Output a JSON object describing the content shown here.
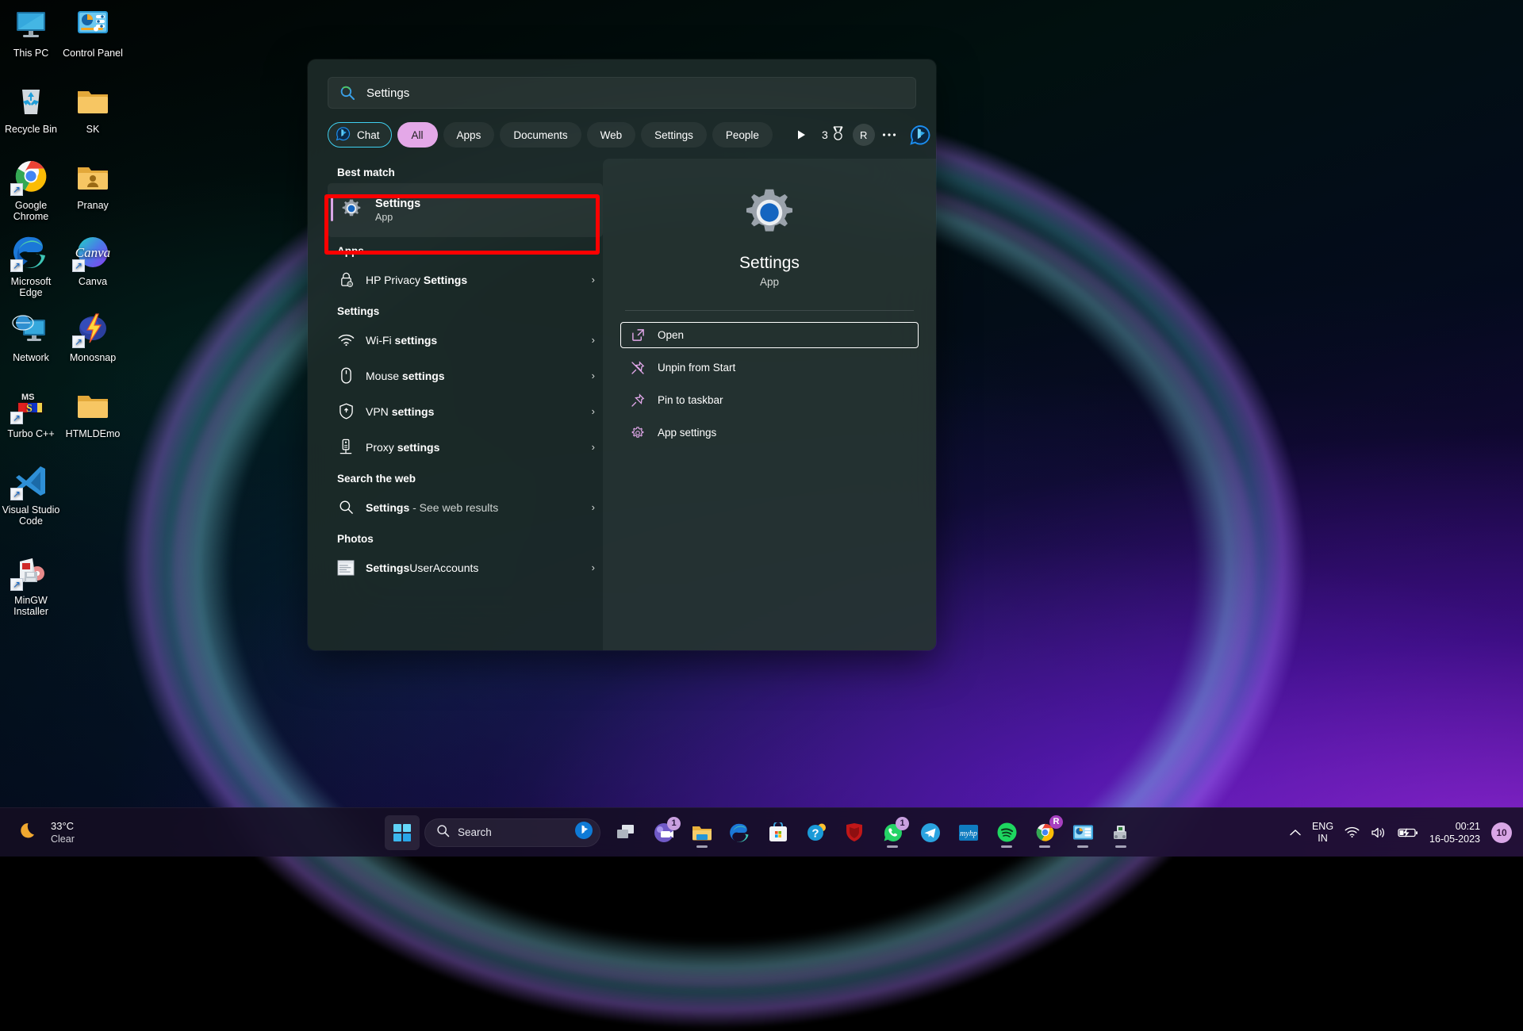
{
  "desktop": {
    "icons": [
      {
        "label": "This PC",
        "icon": "monitor-icon",
        "col": 0,
        "row": 0,
        "shortcut": false
      },
      {
        "label": "Control Panel",
        "icon": "control-panel-icon",
        "col": 1,
        "row": 0,
        "shortcut": false
      },
      {
        "label": "Recycle Bin",
        "icon": "recycle-bin-icon",
        "col": 0,
        "row": 1,
        "shortcut": false
      },
      {
        "label": "SK",
        "icon": "folder-icon",
        "col": 1,
        "row": 1,
        "shortcut": false
      },
      {
        "label": "Google Chrome",
        "icon": "chrome-icon",
        "col": 0,
        "row": 2,
        "shortcut": true
      },
      {
        "label": "Pranay",
        "icon": "user-folder-icon",
        "col": 1,
        "row": 2,
        "shortcut": false
      },
      {
        "label": "Microsoft Edge",
        "icon": "edge-icon",
        "col": 0,
        "row": 3,
        "shortcut": true
      },
      {
        "label": "Canva",
        "icon": "canva-icon",
        "col": 1,
        "row": 3,
        "shortcut": true
      },
      {
        "label": "Network",
        "icon": "network-icon",
        "col": 0,
        "row": 4,
        "shortcut": false
      },
      {
        "label": "Monosnap",
        "icon": "monosnap-icon",
        "col": 1,
        "row": 4,
        "shortcut": true
      },
      {
        "label": "Turbo C++",
        "icon": "turbo-cpp-icon",
        "col": 0,
        "row": 5,
        "shortcut": true
      },
      {
        "label": "HTMLDEmo",
        "icon": "folder-icon",
        "col": 1,
        "row": 5,
        "shortcut": false
      },
      {
        "label": "Visual Studio Code",
        "icon": "vscode-icon",
        "col": 0,
        "row": 6,
        "shortcut": true
      },
      {
        "label": "MinGW Installer",
        "icon": "mingw-installer-icon",
        "col": 0,
        "row": 7,
        "shortcut": true
      }
    ]
  },
  "search": {
    "query": "Settings",
    "placeholder": "Search",
    "search_icon": "bing-search-icon",
    "pills": [
      {
        "label": "Chat",
        "state": "outlined",
        "icon": "bing-chat-icon"
      },
      {
        "label": "All",
        "state": "selected"
      },
      {
        "label": "Apps",
        "state": "normal"
      },
      {
        "label": "Documents",
        "state": "normal"
      },
      {
        "label": "Web",
        "state": "normal"
      },
      {
        "label": "Settings",
        "state": "normal"
      },
      {
        "label": "People",
        "state": "normal"
      }
    ],
    "actions": {
      "scroll_right_icon": "play-right-icon",
      "rewards_count": "3",
      "rewards_icon": "medal-icon",
      "avatar_letter": "R",
      "more_icon": "ellipsis-icon",
      "bing_icon": "bing-chat-icon"
    },
    "best_match": {
      "heading": "Best match",
      "title": "Settings",
      "subtitle": "App",
      "icon": "settings-gear-icon"
    },
    "groups": [
      {
        "heading": "Apps",
        "items": [
          {
            "prefix": "HP Privacy ",
            "bold": "Settings",
            "suffix": "",
            "icon": "hp-privacy-lock-icon",
            "chevron": "›"
          }
        ]
      },
      {
        "heading": "Settings",
        "items": [
          {
            "prefix": "Wi-Fi ",
            "bold": "settings",
            "suffix": "",
            "icon": "wifi-icon",
            "chevron": "›"
          },
          {
            "prefix": "Mouse ",
            "bold": "settings",
            "suffix": "",
            "icon": "mouse-icon",
            "chevron": "›"
          },
          {
            "prefix": "VPN ",
            "bold": "settings",
            "suffix": "",
            "icon": "vpn-shield-icon",
            "chevron": "›"
          },
          {
            "prefix": "Proxy ",
            "bold": "settings",
            "suffix": "",
            "icon": "proxy-server-icon",
            "chevron": "›"
          }
        ]
      },
      {
        "heading": "Search the web",
        "items": [
          {
            "prefix": "",
            "bold": "Settings",
            "suffix": " - See web results",
            "icon": "magnifier-icon",
            "chevron": "›"
          }
        ]
      },
      {
        "heading": "Photos",
        "items": [
          {
            "prefix": "",
            "bold": "Settings",
            "suffix": "UserAccounts",
            "icon": "photo-thumbnail-icon",
            "chevron": "›"
          }
        ]
      }
    ],
    "preview": {
      "icon": "settings-gear-icon",
      "title": "Settings",
      "subtitle": "App",
      "actions": [
        {
          "label": "Open",
          "icon": "open-external-icon",
          "focused": true
        },
        {
          "label": "Unpin from Start",
          "icon": "unpin-icon",
          "focused": false
        },
        {
          "label": "Pin to taskbar",
          "icon": "pin-icon",
          "focused": false
        },
        {
          "label": "App settings",
          "icon": "gear-icon",
          "focused": false
        }
      ]
    }
  },
  "annotation": {
    "color": "#ff0000",
    "target": "best-match-settings-row"
  },
  "taskbar": {
    "weather": {
      "temperature": "33°C",
      "condition": "Clear",
      "icon": "moon-icon"
    },
    "start": {
      "icon": "windows-start-icon",
      "active": true
    },
    "search_box": {
      "placeholder": "Search",
      "icon": "magnifier-icon",
      "bing_icon": "bing-chat-icon"
    },
    "items": [
      {
        "name": "task-view",
        "icon": "task-view-icon",
        "badge": "",
        "running": false
      },
      {
        "name": "teams",
        "icon": "teams-icon",
        "badge": "1",
        "running": false
      },
      {
        "name": "file-explorer",
        "icon": "file-explorer-icon",
        "badge": "",
        "running": true
      },
      {
        "name": "microsoft-edge",
        "icon": "edge-icon",
        "badge": "",
        "running": false
      },
      {
        "name": "microsoft-store",
        "icon": "store-icon",
        "badge": "",
        "running": false
      },
      {
        "name": "get-help",
        "icon": "get-help-icon",
        "badge": "",
        "running": false
      },
      {
        "name": "mcafee",
        "icon": "mcafee-icon",
        "badge": "",
        "running": false
      },
      {
        "name": "whatsapp",
        "icon": "whatsapp-icon",
        "badge": "1",
        "running": true
      },
      {
        "name": "telegram",
        "icon": "telegram-icon",
        "badge": "",
        "running": false
      },
      {
        "name": "myhp",
        "icon": "myhp-icon",
        "badge": "",
        "running": false
      },
      {
        "name": "spotify",
        "icon": "spotify-icon",
        "badge": "",
        "running": true
      },
      {
        "name": "google-chrome",
        "icon": "chrome-icon",
        "badge": "R",
        "running": true
      },
      {
        "name": "control-panel",
        "icon": "control-panel-icon",
        "badge": "",
        "running": true
      },
      {
        "name": "printer-robot",
        "icon": "printer-icon",
        "badge": "",
        "running": true
      }
    ],
    "tray": {
      "overflow_icon": "chevron-up-icon",
      "language": "ENG",
      "region": "IN",
      "wifi_icon": "wifi-icon",
      "volume_icon": "speaker-icon",
      "battery_icon": "battery-charging-icon",
      "time": "00:21",
      "date": "16-05-2023",
      "notification_count": "10"
    }
  }
}
